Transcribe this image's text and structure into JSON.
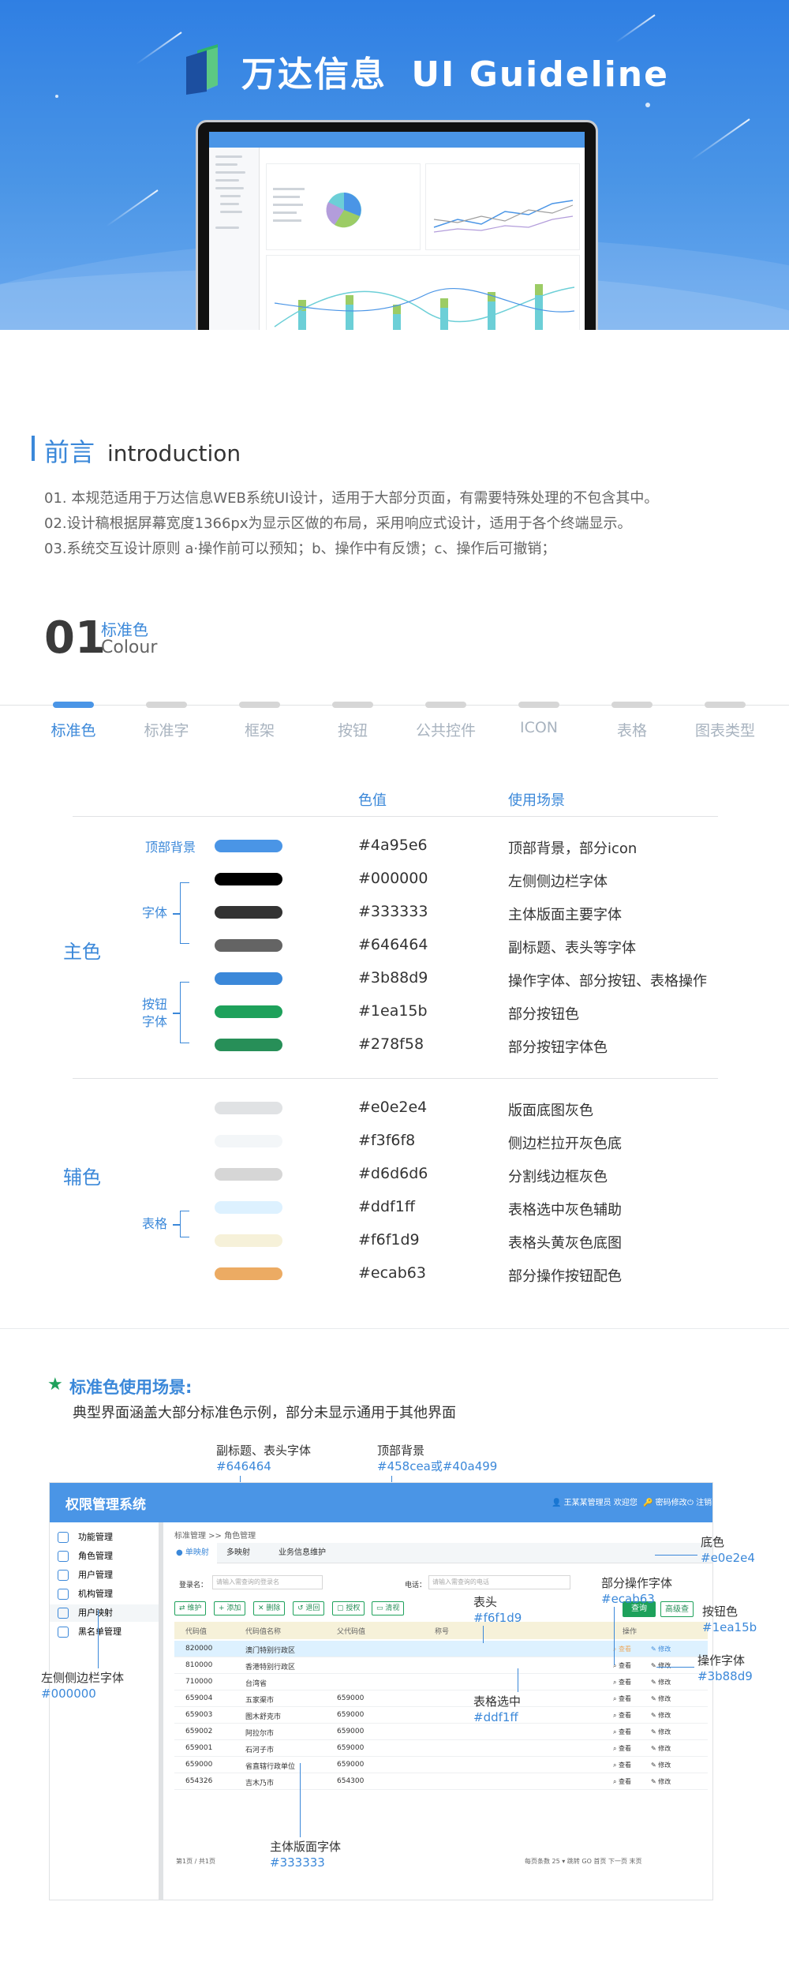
{
  "hero": {
    "brand": "万达信息",
    "title": "UI Guideline"
  },
  "intro": {
    "title_zh": "前言",
    "title_en": "introduction",
    "lines": [
      "01. 本规范适用于万达信息WEB系统UI设计，适用于大部分页面，有需要特殊处理的不包含其中。",
      "02.设计稿根据屏幕宽度1366px为显示区做的布局，采用响应式设计，适用于各个终端显示。",
      "03.系统交互设计原则 a·操作前可以预知；b、操作中有反馈；c、操作后可撤销；"
    ]
  },
  "section": {
    "number": "01",
    "title_zh": "标准色",
    "title_en": "Colour"
  },
  "tabs": [
    "标准色",
    "标准字",
    "框架",
    "按钮",
    "公共控件",
    "ICON",
    "表格",
    "图表类型"
  ],
  "colour_table": {
    "col_value": "色值",
    "col_usage": "使用场景",
    "main_group": "主色",
    "aux_group": "辅色",
    "label_top": "顶部背景",
    "label_font": "字体",
    "label_button_font": [
      "按钮",
      "字体"
    ],
    "label_table": "表格",
    "main_rows": [
      {
        "color": "#4a95e6",
        "hex": "#4a95e6",
        "usage": "顶部背景，部分icon"
      },
      {
        "color": "#000000",
        "hex": "#000000",
        "usage": "左侧侧边栏字体"
      },
      {
        "color": "#333333",
        "hex": "#333333",
        "usage": "主体版面主要字体"
      },
      {
        "color": "#646464",
        "hex": "#646464",
        "usage": "副标题、表头等字体"
      },
      {
        "color": "#3b88d9",
        "hex": "#3b88d9",
        "usage": "操作字体、部分按钮、表格操作"
      },
      {
        "color": "#1ea15b",
        "hex": "#1ea15b",
        "usage": "部分按钮色"
      },
      {
        "color": "#278f58",
        "hex": "#278f58",
        "usage": "部分按钮字体色"
      }
    ],
    "aux_rows": [
      {
        "color": "#e0e2e4",
        "hex": "#e0e2e4",
        "usage": "版面底图灰色"
      },
      {
        "color": "#f3f6f8",
        "hex": "#f3f6f8",
        "usage": "侧边栏拉开灰色底"
      },
      {
        "color": "#d6d6d6",
        "hex": "#d6d6d6",
        "usage": "分割线边框灰色"
      },
      {
        "color": "#ddf1ff",
        "hex": "#ddf1ff",
        "usage": "表格选中灰色辅助"
      },
      {
        "color": "#f6f1d9",
        "hex": "#f6f1d9",
        "usage": "表格头黄灰色底图"
      },
      {
        "color": "#ecab63",
        "hex": "#ecab63",
        "usage": "部分操作按钮配色"
      }
    ]
  },
  "usage": {
    "title": "标准色使用场景:",
    "subtitle": "典型界面涵盖大部分标准色示例，部分未显示通用于其他界面"
  },
  "mock": {
    "app_title": "权限管理系统",
    "top_user": "王某某管理员 欢迎您",
    "top_password": "密码修改",
    "top_logout": "注销",
    "sidebar": [
      "功能管理",
      "角色管理",
      "用户管理",
      "机构管理",
      "用户映射",
      "黑名单管理"
    ],
    "breadcrumb": "标准管理 >> 角色管理",
    "tabs": [
      "单映射",
      "多映射",
      "业务信息维护"
    ],
    "login_label": "登录名：",
    "login_placeholder": "请输入需查询的登录名",
    "phone_label": "电话：",
    "phone_placeholder": "请输入需查询的电话",
    "buttons": [
      "维护",
      "添加",
      "删除",
      "退回",
      "授权",
      "清视"
    ],
    "query_btn": "查询",
    "reset_btn": "高级查",
    "headers": [
      "代码值",
      "代码值名称",
      "父代码值",
      "称号",
      "操作"
    ],
    "rows": [
      [
        "820000",
        "澳门特别行政区",
        ""
      ],
      [
        "810000",
        "香港特别行政区",
        ""
      ],
      [
        "710000",
        "台湾省",
        ""
      ],
      [
        "659004",
        "五家渠市",
        "659000"
      ],
      [
        "659003",
        "图木舒克市",
        "659000"
      ],
      [
        "659002",
        "阿拉尔市",
        "659000"
      ],
      [
        "659001",
        "石河子市",
        "659000"
      ],
      [
        "659000",
        "省直辖行政单位",
        "659000"
      ],
      [
        "654326",
        "吉木乃市",
        "654300"
      ]
    ],
    "op_view": "查看",
    "op_edit": "修改",
    "pager_left": "第1页 / 共1页",
    "pager_right": "每页条数 25 ▾ 跳转 GO 首页 下一页 末页"
  },
  "annotations": {
    "subtitle_font": "副标题、表头字体",
    "subtitle_hex": "#646464",
    "top_bg": "顶部背景",
    "top_bg_hex": "#458cea或#40a499",
    "base_color": "底色",
    "base_hex": "#e0e2e4",
    "part_op_font": "部分操作字体",
    "part_op_hex": "#ecab63",
    "thead": "表头",
    "thead_hex": "#f6f1d9",
    "button_color": "按钮色",
    "button_hex": "#1ea15b",
    "op_font": "操作字体",
    "op_hex": "#3b88d9",
    "side_font": "左侧侧边栏字体",
    "side_hex": "#000000",
    "selected": "表格选中",
    "selected_hex": "#ddf1ff",
    "body_font": "主体版面字体",
    "body_hex": "#333333"
  }
}
